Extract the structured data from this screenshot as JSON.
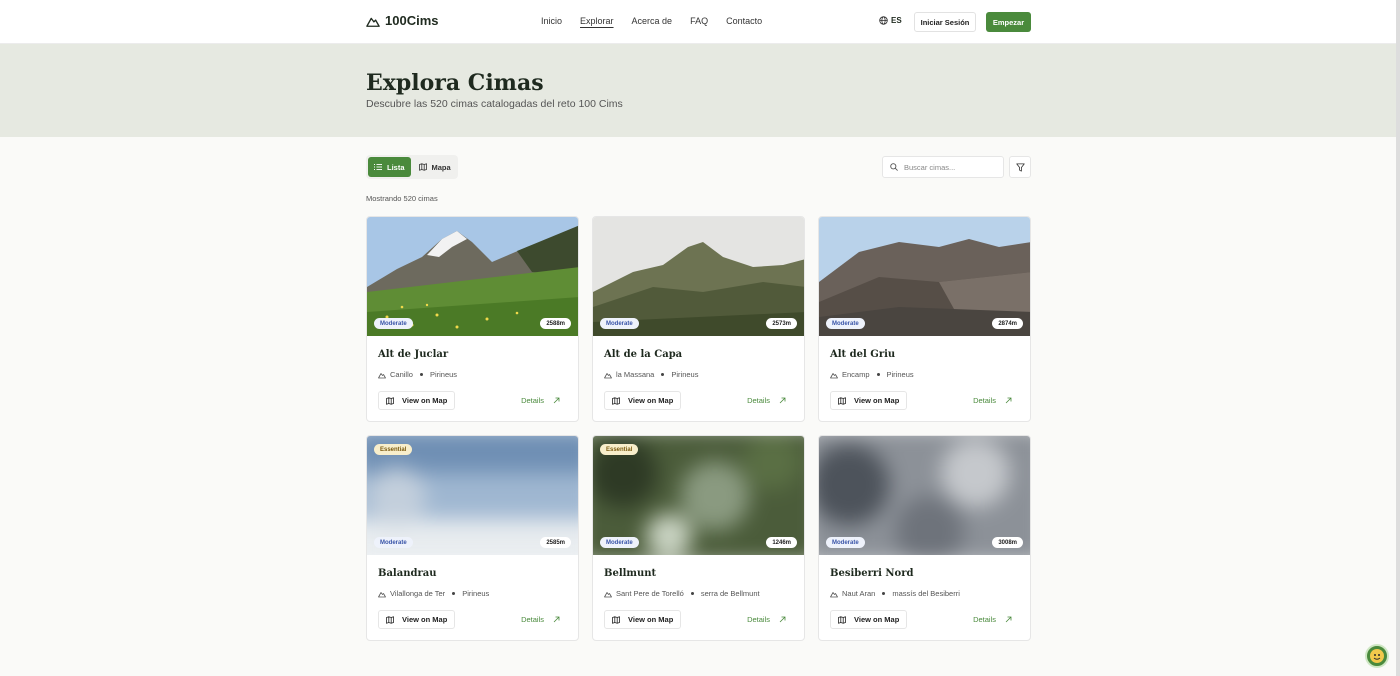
{
  "header": {
    "logo_text": "100Cims",
    "nav": [
      "Inicio",
      "Explorar",
      "Acerca de",
      "FAQ",
      "Contacto"
    ],
    "lang": "ES",
    "login_label": "Iniciar Sesión",
    "start_label": "Empezar"
  },
  "hero": {
    "title": "Explora Cimas",
    "subtitle": "Descubre las 520 cimas catalogadas del reto 100 Cims"
  },
  "toolbar": {
    "list_label": "Lista",
    "map_label": "Mapa",
    "search_placeholder": "Buscar cimas...",
    "count_text": "Mostrando 520 cimas"
  },
  "card_common": {
    "view_map_label": "View on Map",
    "details_label": "Details"
  },
  "cards": [
    {
      "name": "Alt de Juclar",
      "difficulty": "Moderate",
      "altitude": "2588m",
      "town": "Canillo",
      "region": "Pirineus",
      "essential": ""
    },
    {
      "name": "Alt de la Capa",
      "difficulty": "Moderate",
      "altitude": "2573m",
      "town": "la Massana",
      "region": "Pirineus",
      "essential": ""
    },
    {
      "name": "Alt del Griu",
      "difficulty": "Moderate",
      "altitude": "2874m",
      "town": "Encamp",
      "region": "Pirineus",
      "essential": ""
    },
    {
      "name": "Balandrau",
      "difficulty": "Moderate",
      "altitude": "2585m",
      "town": "Vilallonga de Ter",
      "region": "Pirineus",
      "essential": "Essential"
    },
    {
      "name": "Bellmunt",
      "difficulty": "Moderate",
      "altitude": "1246m",
      "town": "Sant Pere de Torelló",
      "region": "serra de Bellmunt",
      "essential": "Essential"
    },
    {
      "name": "Besiberri Nord",
      "difficulty": "Moderate",
      "altitude": "3008m",
      "town": "Naut Aran",
      "region": "massís del Besiberri",
      "essential": ""
    }
  ],
  "colors": {
    "brand_green": "#4a8a3c",
    "hero_bg": "#e6e9e1",
    "difficulty_blue": "#3a55a8"
  }
}
